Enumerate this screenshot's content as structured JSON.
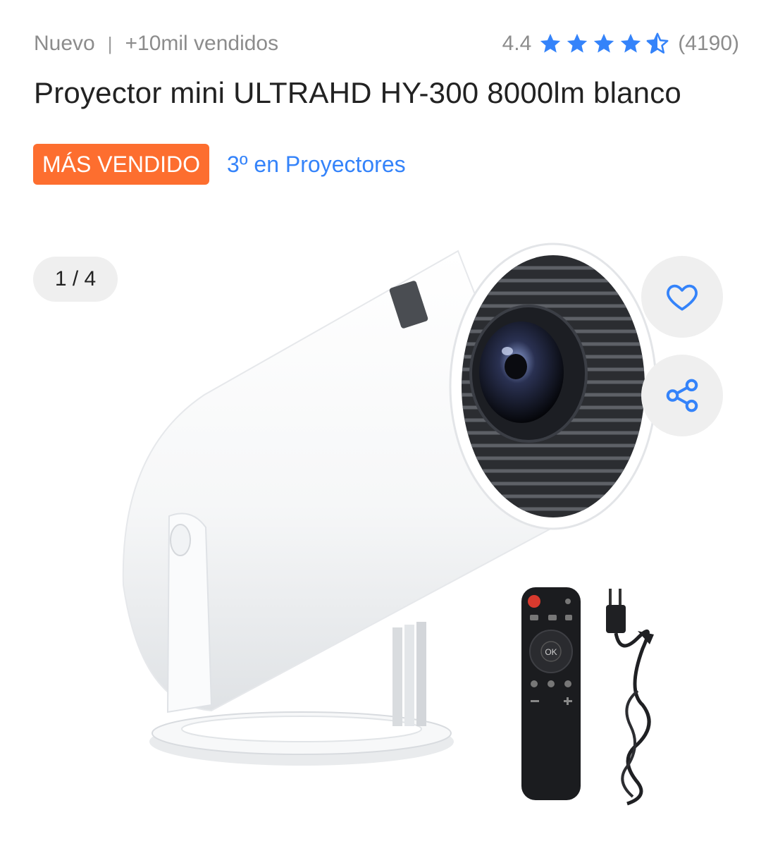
{
  "header": {
    "condition": "Nuevo",
    "separator": "|",
    "sold": "+10mil vendidos",
    "rating_value": "4.4",
    "rating_stars": 4.5,
    "reviews": "(4190)"
  },
  "product": {
    "title": "Proyector mini ULTRAHD HY-300 8000lm blanco",
    "badge": "MÁS VENDIDO",
    "rank_link": "3º en Proyectores"
  },
  "gallery": {
    "counter": "1 / 4",
    "remote_ok_label": "OK"
  },
  "colors": {
    "accent_blue": "#3483fa",
    "badge_orange": "#fd6e2f",
    "muted_text": "#8c8c8c"
  },
  "icons": {
    "favorite": "heart-icon",
    "share": "share-icon",
    "star": "star-icon"
  }
}
